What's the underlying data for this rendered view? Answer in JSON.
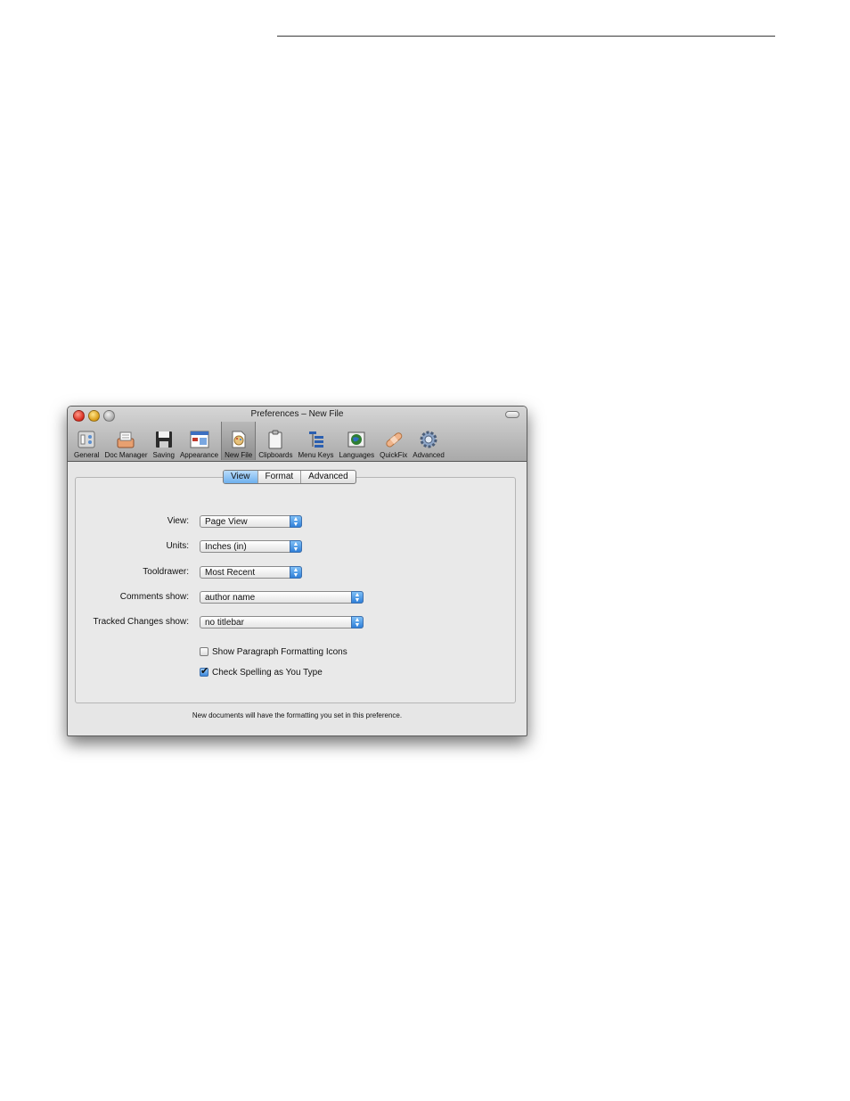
{
  "window": {
    "title": "Preferences – New File"
  },
  "toolbar": {
    "items": [
      {
        "label": "General",
        "icon": "general-icon"
      },
      {
        "label": "Doc Manager",
        "icon": "doc-manager-icon"
      },
      {
        "label": "Saving",
        "icon": "floppy-disk-icon"
      },
      {
        "label": "Appearance",
        "icon": "appearance-icon"
      },
      {
        "label": "New File",
        "icon": "new-file-icon",
        "selected": true
      },
      {
        "label": "Clipboards",
        "icon": "clipboard-icon"
      },
      {
        "label": "Menu Keys",
        "icon": "menu-keys-icon"
      },
      {
        "label": "Languages",
        "icon": "globe-book-icon"
      },
      {
        "label": "QuickFix",
        "icon": "bandage-icon"
      },
      {
        "label": "Advanced",
        "icon": "gear-icon"
      }
    ]
  },
  "tabs": [
    {
      "label": "View",
      "active": true
    },
    {
      "label": "Format",
      "active": false
    },
    {
      "label": "Advanced",
      "active": false
    }
  ],
  "form": {
    "view": {
      "label": "View:",
      "value": "Page View"
    },
    "units": {
      "label": "Units:",
      "value": "Inches (in)"
    },
    "tooldrawer": {
      "label": "Tooldrawer:",
      "value": "Most Recent"
    },
    "comments": {
      "label": "Comments show:",
      "value": "author name"
    },
    "tracked": {
      "label": "Tracked Changes show:",
      "value": "no titlebar"
    },
    "show_paragraph": {
      "label": "Show Paragraph Formatting Icons",
      "checked": false
    },
    "check_spelling": {
      "label": "Check Spelling as You Type",
      "checked": true
    }
  },
  "footer": {
    "text": "New documents will have the formatting you set in this preference."
  },
  "colors": {
    "accent": "#4a95e6",
    "window_bg": "#e6e6e6"
  }
}
